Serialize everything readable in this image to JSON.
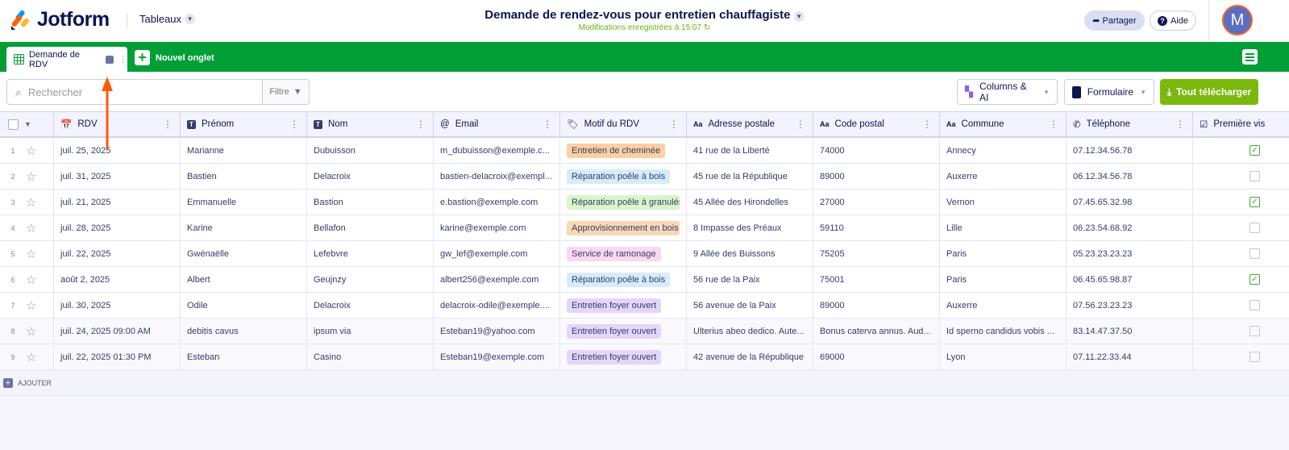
{
  "header": {
    "brand": "Jotform",
    "workspace": "Tableaux",
    "title": "Demande de rendez-vous pour entretien chauffagiste",
    "saved_status": "Modifications enregistrées à 15:07",
    "share_label": "Partager",
    "help_label": "Aide",
    "avatar_initial": "M"
  },
  "tabs": {
    "active": "Demande de RDV",
    "new_tab": "Nouvel onglet"
  },
  "toolbar": {
    "search_placeholder": "Rechercher",
    "filter_label": "Filtre",
    "columns_label": "Columns & AI",
    "form_label": "Formulaire",
    "download_label": "Tout télécharger"
  },
  "columns": [
    "RDV",
    "Prénom",
    "Nom",
    "Email",
    "Motif du RDV",
    "Adresse postale",
    "Code postal",
    "Commune",
    "Téléphone",
    "Première vis"
  ],
  "colors": {
    "green": "#029e36",
    "download": "#7ab80e"
  },
  "rows": [
    {
      "n": "1",
      "rdv": "juil. 25, 2025",
      "prenom": "Marianne",
      "nom": "Dubuisson",
      "email": "m_dubuisson@exemple.c...",
      "motif": "Entretien de cheminée",
      "motif_color": "#fdd0a2",
      "adresse": "41 rue de la Liberté",
      "cp": "74000",
      "commune": "Annecy",
      "tel": "07.12.34.56.78",
      "premiere": true
    },
    {
      "n": "2",
      "rdv": "juil. 31, 2025",
      "prenom": "Bastien",
      "nom": "Delacroix",
      "email": "bastien-delacroix@exempl...",
      "motif": "Réparation poêle à bois",
      "motif_color": "#d6ecfb",
      "adresse": "45 rue de la République",
      "cp": "89000",
      "commune": "Auxerre",
      "tel": "06.12.34.56.78",
      "premiere": false
    },
    {
      "n": "3",
      "rdv": "juil. 21, 2025",
      "prenom": "Emmanuelle",
      "nom": "Bastion",
      "email": "e.bastion@exemple.com",
      "motif": "Réparation poêle à granulés",
      "motif_color": "#d9f5c9",
      "adresse": "45 Allée des Hirondelles",
      "cp": "27000",
      "commune": "Vernon",
      "tel": "07.45.65.32.98",
      "premiere": true
    },
    {
      "n": "4",
      "rdv": "juil. 28, 2025",
      "prenom": "Karine",
      "nom": "Bellafon",
      "email": "karine@exemple.com",
      "motif": "Approvisionnement en bois",
      "motif_color": "#f9d8b5",
      "adresse": "8 Impasse des Préaux",
      "cp": "59110",
      "commune": "Lille",
      "tel": "06.23.54.68.92",
      "premiere": false
    },
    {
      "n": "5",
      "rdv": "juil. 22, 2025",
      "prenom": "Gwénaëlle",
      "nom": "Lefebvre",
      "email": "gw_lef@exemple.com",
      "motif": "Service de ramonage",
      "motif_color": "#fad8f0",
      "adresse": "9 Allée des Buissons",
      "cp": "75205",
      "commune": "Paris",
      "tel": "05.23.23.23.23",
      "premiere": false
    },
    {
      "n": "6",
      "rdv": "août 2, 2025",
      "prenom": "Albert",
      "nom": "Geujnzy",
      "email": "albert256@exemple.com",
      "motif": "Réparation poêle à bois",
      "motif_color": "#d6ecfb",
      "adresse": "56 rue de la Paix",
      "cp": "75001",
      "commune": "Paris",
      "tel": "06.45.65.98.87",
      "premiere": true
    },
    {
      "n": "7",
      "rdv": "juil. 30, 2025",
      "prenom": "Odile",
      "nom": "Delacroix",
      "email": "delacroix-odile@exemple....",
      "motif": "Entretien foyer ouvert",
      "motif_color": "#e3d6fb",
      "adresse": "56 avenue de la Paix",
      "cp": "89000",
      "commune": "Auxerre",
      "tel": "07.56.23.23.23",
      "premiere": false
    },
    {
      "n": "8",
      "rdv": "juil. 24, 2025 09:00 AM",
      "prenom": "debitis cavus",
      "nom": "ipsum via",
      "email": "Esteban19@yahoo.com",
      "motif": "Entretien foyer ouvert",
      "motif_color": "#e3d6fb",
      "adresse": "Ulterius abeo dedico. Aute...",
      "cp": "Bonus caterva annus. Aud...",
      "commune": "Id sperno candidus vobis ...",
      "tel": "83.14.47.37.50",
      "premiere": false
    },
    {
      "n": "9",
      "rdv": "juil. 22, 2025 01:30 PM",
      "prenom": "Esteban",
      "nom": "Casino",
      "email": "Esteban19@exemple.com",
      "motif": "Entretien foyer ouvert",
      "motif_color": "#e3d6fb",
      "adresse": "42 avenue de la République",
      "cp": "69000",
      "commune": "Lyon",
      "tel": "07.11.22.33.44",
      "premiere": false
    }
  ],
  "add_label": "AJOUTER"
}
